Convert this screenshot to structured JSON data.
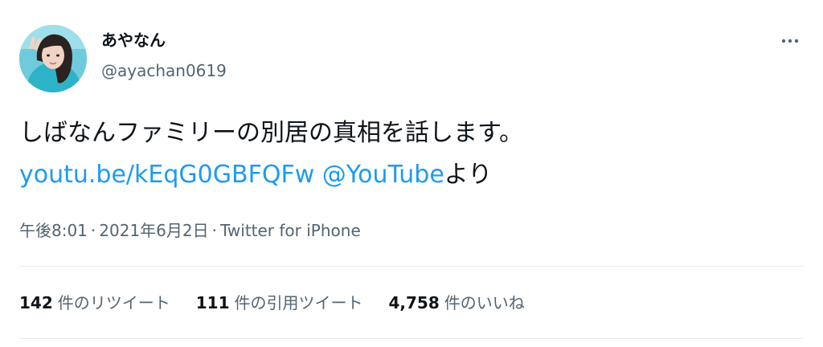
{
  "user": {
    "display_name": "あやなん",
    "handle": "@ayachan0619"
  },
  "tweet": {
    "line1": "しばなんファミリーの別居の真相を話します。",
    "link_text": "youtu.be/kEqG0GBFQFw",
    "mention_text": "@YouTube",
    "trailing_text": "より"
  },
  "meta": {
    "time": "午後8:01",
    "separator": "·",
    "date": "2021年6月2日",
    "source": "Twitter for iPhone"
  },
  "stats": {
    "retweets_count": "142",
    "retweets_label": "件のリツイート",
    "quotes_count": "111",
    "quotes_label": "件の引用ツイート",
    "likes_count": "4,758",
    "likes_label": "件のいいね"
  },
  "colors": {
    "link": "#1d9bf0",
    "secondary_text": "#536471",
    "primary_text": "#0f1419",
    "divider": "#e6e9ea"
  },
  "icons": {
    "more": "more-horizontal-icon"
  }
}
